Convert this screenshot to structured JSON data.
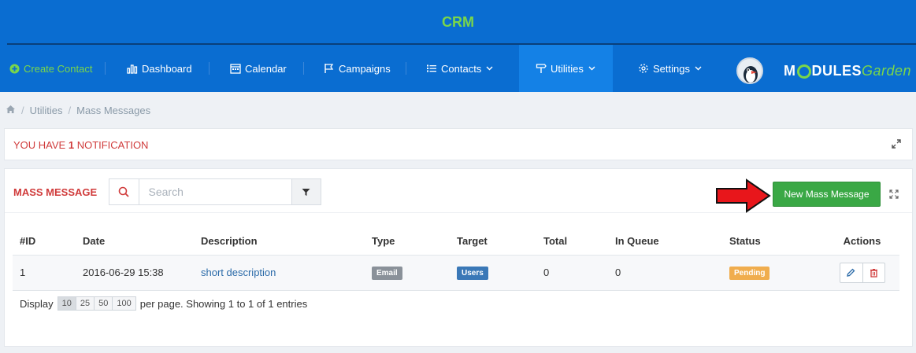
{
  "app": {
    "title": "CRM"
  },
  "nav": {
    "create_contact": "Create Contact",
    "dashboard": "Dashboard",
    "calendar": "Calendar",
    "campaigns": "Campaigns",
    "contacts": "Contacts",
    "utilities": "Utilities",
    "settings": "Settings"
  },
  "logo": {
    "part1": "M",
    "part2": "DULES",
    "part3": "Garden"
  },
  "breadcrumb": {
    "items": [
      "Utilities",
      "Mass Messages"
    ]
  },
  "notification": {
    "prefix": "YOU HAVE ",
    "count": "1",
    "suffix": " NOTIFICATION"
  },
  "panel": {
    "title": "MASS MESSAGE",
    "search_placeholder": "Search",
    "new_button": "New Mass Message"
  },
  "table": {
    "headers": [
      "#ID",
      "Date",
      "Description",
      "Type",
      "Target",
      "Total",
      "In Queue",
      "Status",
      "Actions"
    ],
    "rows": [
      {
        "id": "1",
        "date": "2016-06-29 15:38",
        "description": "short description",
        "type": "Email",
        "target": "Users",
        "total": "0",
        "in_queue": "0",
        "status": "Pending"
      }
    ]
  },
  "footer": {
    "display_label": "Display",
    "page_sizes": [
      "10",
      "25",
      "50",
      "100"
    ],
    "summary": "per page. Showing 1 to 1 of 1 entries"
  },
  "colors": {
    "topbar": "#0a6dd1",
    "accent_green": "#7ad64a",
    "alert_red": "#d03b3b",
    "button_green": "#3aa845"
  }
}
